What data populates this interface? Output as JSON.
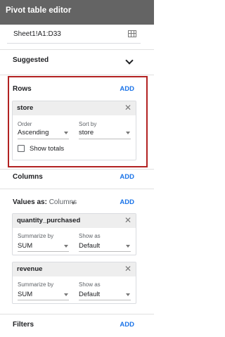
{
  "header": {
    "title": "Pivot table editor"
  },
  "range": {
    "value": "Sheet1!A1:D33",
    "icon": "grid-select-icon"
  },
  "suggested": {
    "label": "Suggested",
    "icon": "chevron-down-icon"
  },
  "rows": {
    "label": "Rows",
    "add": "ADD",
    "card": {
      "title": "store",
      "order_label": "Order",
      "order_value": "Ascending",
      "sortby_label": "Sort by",
      "sortby_value": "store",
      "show_totals": "Show totals",
      "show_totals_checked": false
    }
  },
  "columns": {
    "label": "Columns",
    "add": "ADD"
  },
  "values": {
    "label": "Values as:",
    "as_value": "Columns",
    "add": "ADD",
    "cards": [
      {
        "title": "quantity_purchased",
        "summarize_label": "Summarize by",
        "summarize_value": "SUM",
        "showas_label": "Show as",
        "showas_value": "Default"
      },
      {
        "title": "revenue",
        "summarize_label": "Summarize by",
        "summarize_value": "SUM",
        "showas_label": "Show as",
        "showas_value": "Default"
      }
    ]
  },
  "filters": {
    "label": "Filters",
    "add": "ADD"
  },
  "colors": {
    "header_bg": "#646464",
    "accent": "#1a73e8",
    "highlight": "#b22222"
  }
}
